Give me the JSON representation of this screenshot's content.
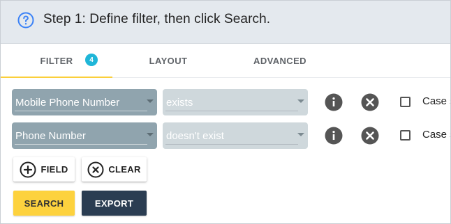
{
  "header": {
    "title": "Step 1: Define filter, then click Search.",
    "icon": "help-circle-icon"
  },
  "tabs": [
    {
      "label": "FILTER",
      "badge": "4",
      "active": true
    },
    {
      "label": "LAYOUT",
      "active": false
    },
    {
      "label": "ADVANCED",
      "active": false
    }
  ],
  "filters": [
    {
      "field": "Mobile Phone Number",
      "operator": "exists",
      "case_label": "Case s",
      "case_checked": false
    },
    {
      "field": "Phone Number",
      "operator": "doesn't exist",
      "case_label": "Case s",
      "case_checked": false
    }
  ],
  "buttons": {
    "add_field": "FIELD",
    "clear": "CLEAR",
    "search": "SEARCH",
    "export": "EXPORT"
  },
  "colors": {
    "accent_yellow": "#fdd23e",
    "badge_cyan": "#1fb6d8",
    "export_navy": "#2b3d52",
    "field_select": "#90a4ae",
    "operator_select": "#cfd8dc",
    "help_icon_blue": "#3b82f6"
  }
}
